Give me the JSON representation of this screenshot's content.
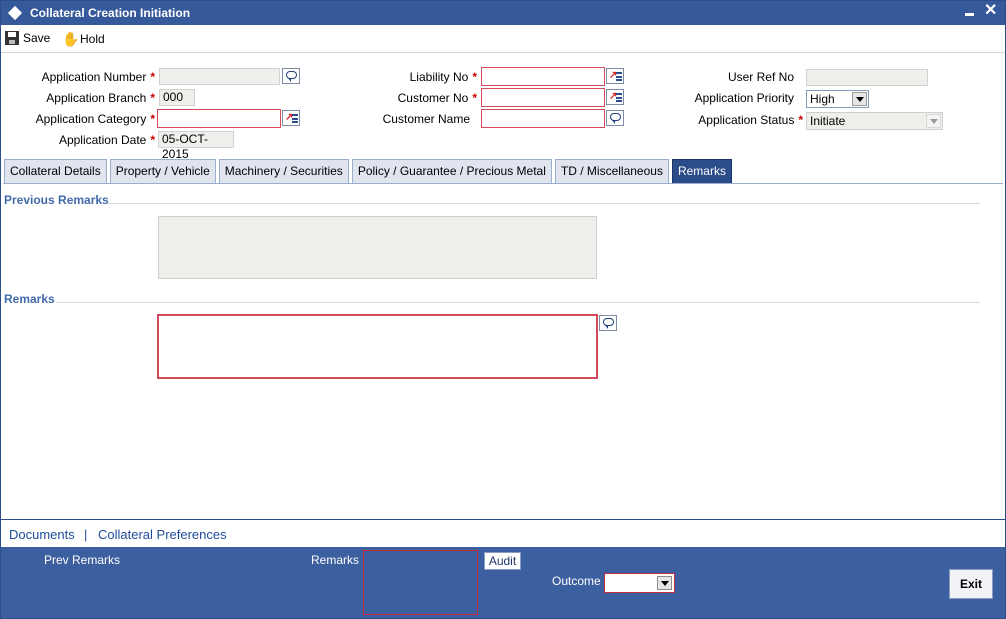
{
  "window": {
    "title": "Collateral Creation Initiation"
  },
  "toolbar": {
    "save_label": "Save",
    "hold_label": "Hold"
  },
  "form": {
    "application_number": {
      "label": "Application Number",
      "value": ""
    },
    "application_branch": {
      "label": "Application Branch",
      "value": "000"
    },
    "application_category": {
      "label": "Application Category",
      "value": ""
    },
    "application_date": {
      "label": "Application Date",
      "value": "05-OCT-2015"
    },
    "liability_no": {
      "label": "Liability No",
      "value": ""
    },
    "customer_no": {
      "label": "Customer No",
      "value": ""
    },
    "customer_name": {
      "label": "Customer Name",
      "value": ""
    },
    "user_ref_no": {
      "label": "User Ref No",
      "value": ""
    },
    "application_priority": {
      "label": "Application Priority",
      "value": "High"
    },
    "application_status": {
      "label": "Application Status",
      "value": "Initiate"
    },
    "required_marker": "*"
  },
  "tabs": [
    {
      "label": "Collateral Details"
    },
    {
      "label": "Property / Vehicle"
    },
    {
      "label": "Machinery / Securities"
    },
    {
      "label": "Policy / Guarantee / Precious Metal"
    },
    {
      "label": "TD / Miscellaneous"
    },
    {
      "label": "Remarks",
      "active": true
    }
  ],
  "remarks_tab": {
    "previous_remarks_title": "Previous Remarks",
    "previous_remarks_value": "",
    "remarks_title": "Remarks",
    "remarks_value": ""
  },
  "links": {
    "documents": "Documents",
    "separator": "|",
    "collateral_preferences": "Collateral Preferences"
  },
  "footer": {
    "prev_remarks_label": "Prev Remarks",
    "remarks_label": "Remarks",
    "audit_label": "Audit",
    "outcome_label": "Outcome",
    "outcome_value": "",
    "exit_label": "Exit"
  },
  "colors": {
    "titlebar": "#36599b",
    "footer": "#3c5f9f",
    "active_tab": "#2b4d8a",
    "mandatory_border": "#d34a5a",
    "section_title": "#436aab"
  }
}
